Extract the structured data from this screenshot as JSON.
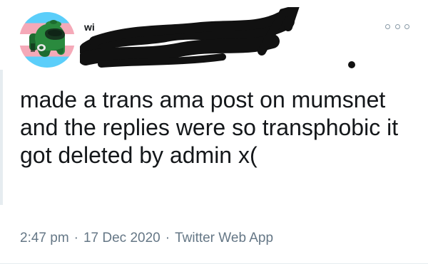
{
  "author": {
    "display_name": "wi",
    "avatar_icon": "among-us-crewmate-icon",
    "flag_colors": [
      "#5BCEFA",
      "#F5A9B8",
      "#FFFFFF"
    ]
  },
  "tweet": {
    "text": "made a trans ama post on mumsnet and the replies were so transphobic it got deleted by admin x(",
    "time": "2:47 pm",
    "date": "17 Dec 2020",
    "source": "Twitter Web App",
    "separator": "·"
  },
  "icons": {
    "more": "more-options-icon"
  },
  "colors": {
    "text": "#14171a",
    "meta": "#657786",
    "crewmate": "#1d6b2f"
  }
}
